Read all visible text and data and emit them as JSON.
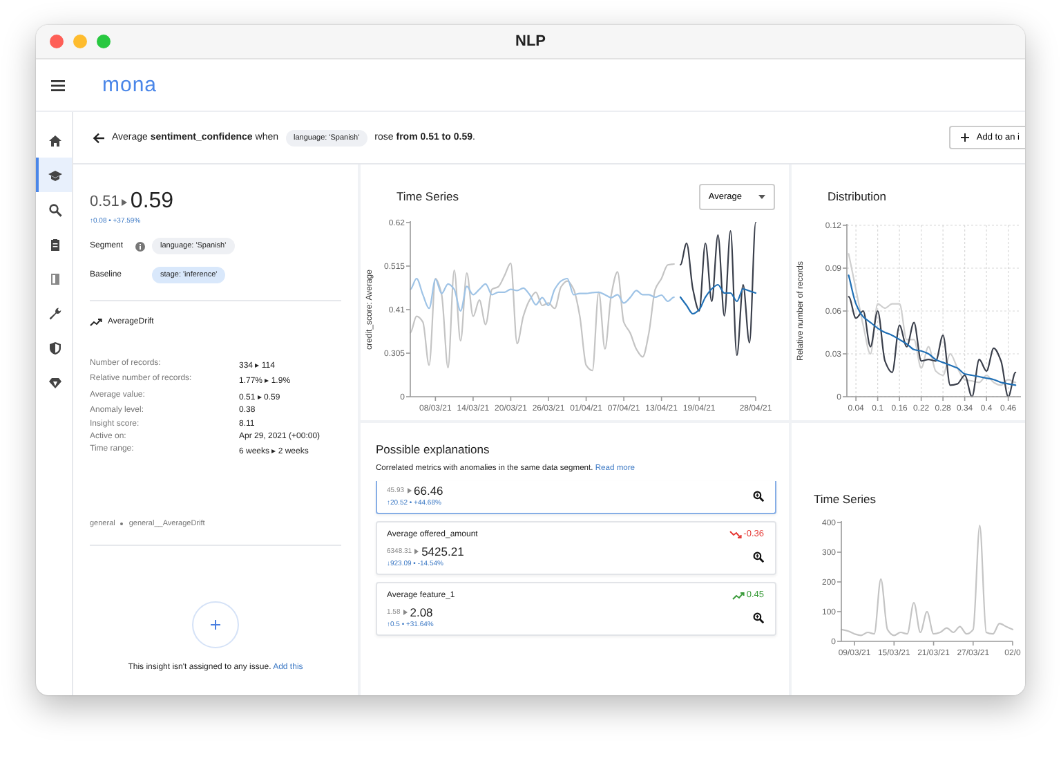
{
  "window": {
    "title": "NLP"
  },
  "app": {
    "logo": "mona"
  },
  "sidebar": {
    "items": [
      {
        "kind": "home",
        "selected": false
      },
      {
        "kind": "school",
        "selected": true
      },
      {
        "kind": "search",
        "selected": false
      },
      {
        "kind": "clipboard",
        "selected": false
      },
      {
        "kind": "book",
        "selected": false
      },
      {
        "kind": "wrench",
        "selected": false
      },
      {
        "kind": "shield",
        "selected": false
      },
      {
        "kind": "gem",
        "selected": false
      }
    ]
  },
  "header": {
    "prefix": "Average **sentiment_confidence** when",
    "chip": "language: 'Spanish'",
    "suffix": "rose **from 0.51 to 0.59**.",
    "button": "Add to an i"
  },
  "summary": {
    "from": "0.51",
    "to": "0.59",
    "delta": "↑0.08 • +37.59%",
    "segment_label": "Segment",
    "segment_chip": "language: 'Spanish'",
    "baseline_label": "Baseline",
    "baseline_chip": "stage: 'inference'",
    "insight_type": "AverageDrift",
    "stats": [
      {
        "label": "Number of records:",
        "value": "334 ▸ 114"
      },
      {
        "label": "Relative number of records:",
        "value": "1.77% ▸ 1.9%"
      },
      {
        "label": "Average value:",
        "value": "0.51 ▸ 0.59"
      },
      {
        "label": "Anomaly level:",
        "value": "0.38"
      },
      {
        "label": "Insight score:",
        "value": "8.11"
      },
      {
        "label": "Active on:",
        "value": "Apr 29, 2021 (+00:00)"
      },
      {
        "label": "Time range:",
        "value": "6 weeks ▸ 2 weeks"
      }
    ],
    "tags": [
      "general",
      "general__AverageDrift"
    ],
    "assign_text": "This insight isn't assigned to any issue.",
    "assign_link": "Add this"
  },
  "time_series": {
    "title": "Time Series",
    "aggregation": "Average",
    "chart_data": {
      "type": "line",
      "ylabel": "credit_score: Average",
      "categories": [
        null,
        null,
        null,
        null,
        "08/03/21",
        null,
        null,
        null,
        null,
        null,
        "14/03/21",
        null,
        null,
        null,
        null,
        null,
        "20/03/21",
        null,
        null,
        null,
        null,
        null,
        "26/03/21",
        null,
        null,
        null,
        null,
        null,
        "01/04/21",
        null,
        null,
        null,
        null,
        null,
        "07/04/21",
        null,
        null,
        null,
        null,
        null,
        "13/04/21",
        null,
        null,
        null,
        null,
        null,
        "19/04/21",
        null,
        null,
        null,
        null,
        null,
        null,
        null,
        null,
        "28/04/21"
      ],
      "series": [
        {
          "color": "#c4c4c4",
          "values": [
            0.354,
            0.394,
            0.38,
            0.276,
            0.485,
            0.446,
            0.27,
            0.505,
            0.335,
            0.498,
            0.394,
            0.433,
            0.374,
            0.459,
            0.465,
            0.492,
            0.522,
            0.328,
            0.394,
            0.433,
            0.452,
            0.42,
            0.426,
            0.413,
            0.465,
            0.479,
            0.459,
            0.394,
            0.276,
            0.263,
            0.452,
            0.315,
            0.446,
            0.501,
            0.38,
            0.354,
            0.315,
            0.296,
            0.354,
            0.459,
            0.485,
            0.518,
            0.52,
            null,
            null,
            null,
            null,
            null,
            null,
            null,
            null,
            null,
            null,
            null,
            null,
            null
          ]
        },
        {
          "color": "#9ec3e6",
          "values": [
            0.459,
            0.485,
            0.446,
            0.413,
            0.483,
            0.449,
            0.472,
            0.459,
            0.407,
            0.466,
            0.446,
            0.459,
            0.472,
            0.446,
            0.452,
            0.452,
            0.459,
            0.456,
            0.462,
            0.446,
            0.422,
            0.439,
            0.42,
            0.459,
            0.479,
            0.485,
            0.446,
            0.449,
            0.449,
            0.451,
            0.452,
            0.446,
            0.439,
            0.446,
            0.426,
            0.439,
            0.456,
            0.446,
            0.446,
            0.44,
            0.445,
            0.43,
            0.44,
            null,
            null,
            null,
            null,
            null,
            null,
            null,
            null,
            null,
            null,
            null,
            null,
            null
          ]
        },
        {
          "color": "#3a3f4b",
          "values": [
            null,
            null,
            null,
            null,
            null,
            null,
            null,
            null,
            null,
            null,
            null,
            null,
            null,
            null,
            null,
            null,
            null,
            null,
            null,
            null,
            null,
            null,
            null,
            null,
            null,
            null,
            null,
            null,
            null,
            null,
            null,
            null,
            null,
            null,
            null,
            null,
            null,
            null,
            null,
            null,
            null,
            null,
            null,
            0.518,
            0.57,
            0.46,
            0.407,
            0.57,
            0.43,
            0.59,
            0.395,
            0.6,
            0.3,
            0.47,
            0.33,
            0.62
          ]
        },
        {
          "color": "#1f6fb5",
          "values": [
            null,
            null,
            null,
            null,
            null,
            null,
            null,
            null,
            null,
            null,
            null,
            null,
            null,
            null,
            null,
            null,
            null,
            null,
            null,
            null,
            null,
            null,
            null,
            null,
            null,
            null,
            null,
            null,
            null,
            null,
            null,
            null,
            null,
            null,
            null,
            null,
            null,
            null,
            null,
            null,
            null,
            null,
            null,
            0.44,
            0.42,
            0.4,
            0.41,
            0.44,
            0.46,
            0.47,
            0.45,
            0.45,
            0.43,
            0.46,
            0.455,
            0.45
          ]
        }
      ],
      "ylim": [
        0.2,
        0.62
      ],
      "yticks": [
        {
          "value": 0.2,
          "label": "0"
        },
        0.305,
        0.41,
        0.515,
        0.62
      ]
    }
  },
  "distribution": {
    "title": "Distribution",
    "chart_data": {
      "type": "line",
      "ylabel": "Relative number of records",
      "x": [
        0.02,
        0.04,
        0.06,
        0.08,
        0.1,
        0.12,
        0.14,
        0.16,
        0.18,
        0.2,
        0.22,
        0.24,
        0.26,
        0.28,
        0.3,
        0.32,
        0.34,
        0.36,
        0.38,
        0.4,
        0.42,
        0.44,
        0.46,
        0.48
      ],
      "series": [
        {
          "color": "#cfcfcf",
          "values": [
            0.1,
            0.075,
            0.05,
            0.03,
            0.065,
            0.062,
            0.065,
            0.065,
            0.04,
            0.04,
            0.02,
            0.035,
            0.018,
            0.015,
            0.03,
            0.02,
            0.012,
            0.011,
            0.01,
            0.015,
            0.01,
            0.008,
            0.012,
            0.01
          ]
        },
        {
          "color": "#3a3f4b",
          "values": [
            0.07,
            0.055,
            0.06,
            0.035,
            0.06,
            0.025,
            0.017,
            0.05,
            0.035,
            0.052,
            0.025,
            0.026,
            0.025,
            0.043,
            0.008,
            0.009,
            0.015,
            0.0,
            0.026,
            0.018,
            0.034,
            0.025,
            0.0,
            0.017
          ]
        },
        {
          "color": "#1f6fb5",
          "values": [
            0.085,
            0.065,
            0.056,
            0.052,
            0.048,
            0.045,
            0.043,
            0.04,
            0.037,
            0.033,
            0.032,
            0.03,
            0.026,
            0.024,
            0.022,
            0.02,
            0.016,
            0.015,
            0.014,
            0.013,
            0.012,
            0.01,
            0.009,
            0.008
          ]
        }
      ],
      "xlim": [
        0.015,
        0.495
      ],
      "ylim": [
        0,
        0.12
      ],
      "grid": true,
      "xticks": [
        0.04,
        0.1,
        0.16,
        0.22,
        0.28,
        0.34,
        0.4,
        0.46
      ],
      "yticks": [
        0,
        0.03,
        0.06,
        0.09,
        0.12
      ]
    }
  },
  "explanations": {
    "title": "Possible explanations",
    "description": "Correlated metrics with anomalies in the same data segment.",
    "link": "Read more",
    "cards": [
      {
        "selected": true,
        "from": "45.93",
        "to": "66.46",
        "delta": "↑20.52 • +44.68%"
      },
      {
        "selected": false,
        "name": "Average offered_amount",
        "kind": "negative",
        "correlation": "-0.36",
        "from": "6348.31",
        "to": "5425.21",
        "delta": "↓923.09 • -14.54%"
      },
      {
        "selected": false,
        "name": "Average feature_1",
        "kind": "positive",
        "correlation": "0.45",
        "from": "1.58",
        "to": "2.08",
        "delta": "↑0.5 • +31.64%"
      }
    ]
  },
  "feature_series": {
    "title": "Time Series",
    "chart_data": {
      "type": "line",
      "categories": [
        null,
        null,
        "09/03/21",
        null,
        null,
        null,
        null,
        null,
        "15/03/21",
        null,
        null,
        null,
        null,
        null,
        "21/03/21",
        null,
        null,
        null,
        null,
        null,
        "27/03/21",
        null,
        null,
        null,
        null,
        null,
        "02/0"
      ],
      "series": [
        {
          "color": "#c4c4c4",
          "values": [
            40,
            35,
            25,
            20,
            30,
            25,
            210,
            40,
            20,
            30,
            25,
            130,
            30,
            100,
            25,
            30,
            45,
            30,
            50,
            25,
            40,
            390,
            30,
            25,
            60,
            50,
            40
          ]
        }
      ],
      "ylim": [
        0,
        400
      ],
      "yticks": [
        0,
        100,
        200,
        300,
        400
      ]
    }
  }
}
